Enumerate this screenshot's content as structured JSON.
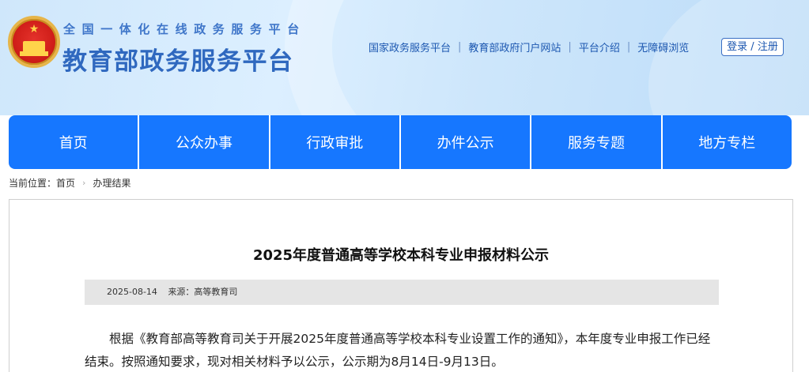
{
  "header": {
    "subtitle": "全国一体化在线政务服务平台",
    "title": "教育部政务服务平台",
    "links": [
      "国家政务服务平台",
      "教育部政府门户网站",
      "平台介绍",
      "无障碍浏览"
    ],
    "login_label": "登录 / 注册"
  },
  "nav": {
    "items": [
      "首页",
      "公众办事",
      "行政审批",
      "办件公示",
      "服务专题",
      "地方专栏"
    ]
  },
  "breadcrumb": {
    "prefix": "当前位置：",
    "home": "首页",
    "current": "办理结果"
  },
  "article": {
    "title": "2025年度普通高等学校本科专业申报材料公示",
    "date": "2025-08-14",
    "source": "来源：高等教育司",
    "body": "根据《教育部高等教育司关于开展2025年度普通高等学校本科专业设置工作的通知》，本年度专业申报工作已经结束。按照通知要求，现对相关材料予以公示，公示期为8月14日-9月13日。"
  },
  "colors": {
    "nav_bg": "#1677ff",
    "title_blue": "#2f68bf",
    "meta_bg": "#e5e5e5"
  }
}
